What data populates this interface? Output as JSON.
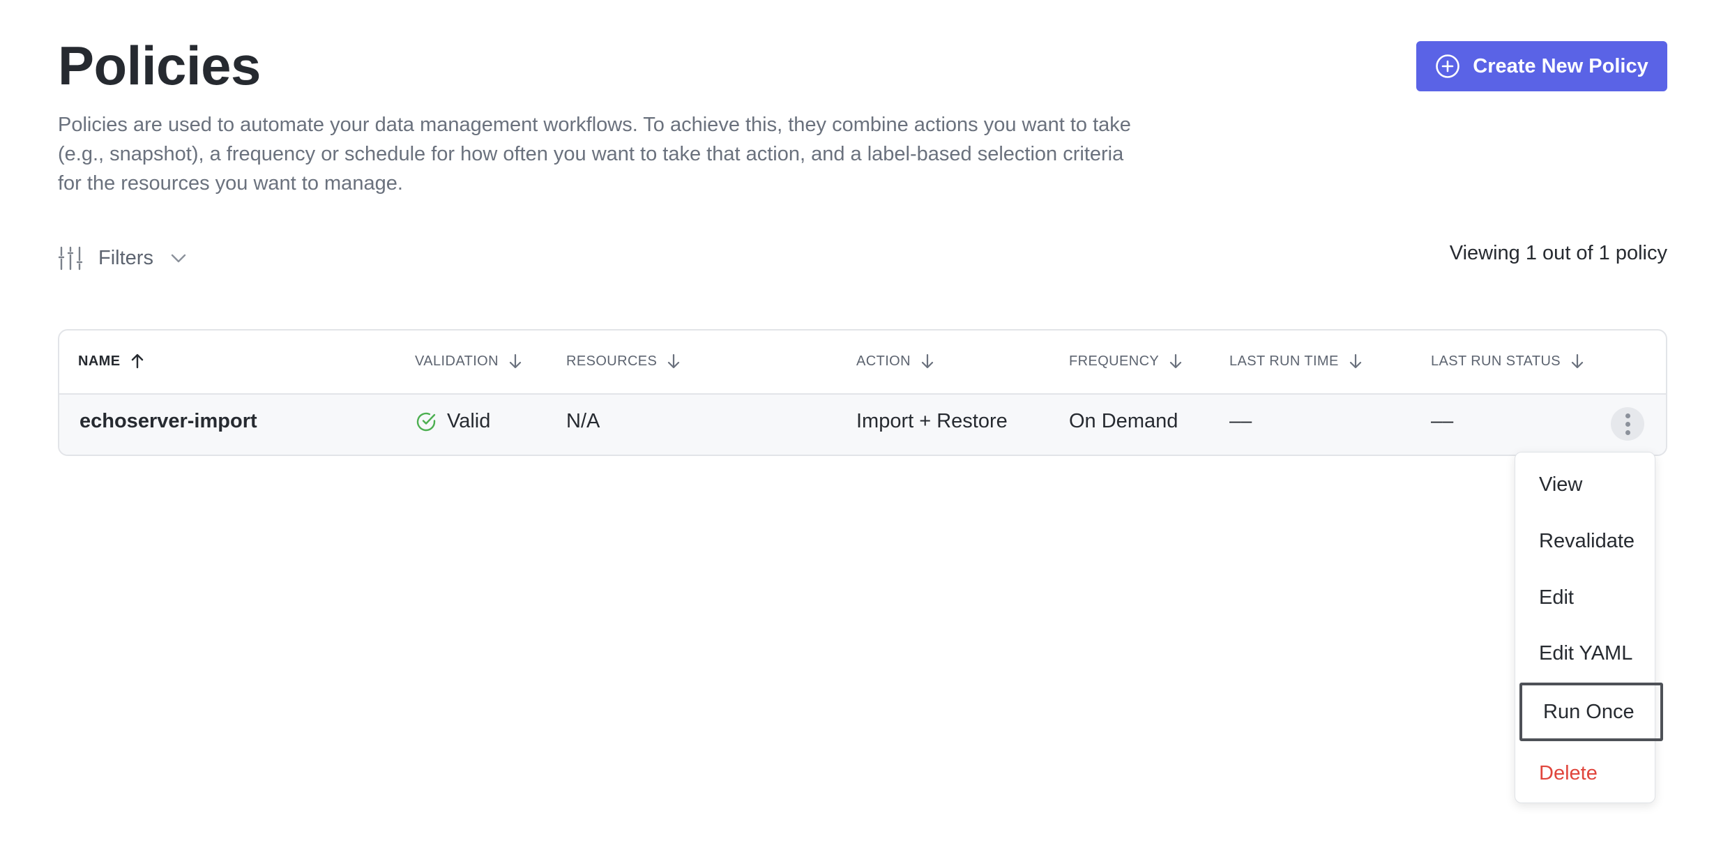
{
  "header": {
    "title": "Policies",
    "description": "Policies are used to automate your data management workflows. To achieve this, they combine actions you want to take (e.g., snapshot), a frequency or schedule for how often you want to take that action, and a label-based selection criteria for the resources you want to manage.",
    "create_button_label": "Create New Policy"
  },
  "toolbar": {
    "filters_label": "Filters",
    "viewing_text": "Viewing 1 out of 1 policy"
  },
  "table": {
    "columns": [
      {
        "label": "NAME",
        "sort": "asc",
        "active": true
      },
      {
        "label": "VALIDATION",
        "sort": "desc"
      },
      {
        "label": "RESOURCES",
        "sort": "desc"
      },
      {
        "label": "ACTION",
        "sort": "desc"
      },
      {
        "label": "FREQUENCY",
        "sort": "desc"
      },
      {
        "label": "LAST RUN TIME",
        "sort": "desc"
      },
      {
        "label": "LAST RUN STATUS",
        "sort": "desc"
      }
    ],
    "rows": [
      {
        "name": "echoserver-import",
        "validation": "Valid",
        "resources": "N/A",
        "action": "Import + Restore",
        "frequency": "On Demand",
        "last_run_time": "––",
        "last_run_status": "––"
      }
    ]
  },
  "row_menu": {
    "items": [
      {
        "label": "View"
      },
      {
        "label": "Revalidate"
      },
      {
        "label": "Edit"
      },
      {
        "label": "Edit YAML"
      },
      {
        "label": "Run Once",
        "focused": true
      },
      {
        "label": "Delete",
        "danger": true
      }
    ]
  },
  "colors": {
    "primary": "#5a63e6",
    "valid": "#4caf50",
    "danger": "#e0453c",
    "text": "#262a30",
    "muted": "#6a717d"
  },
  "icons": {
    "create": "plus-circle-icon",
    "filters": "sliders-icon",
    "filters_toggle": "chevron-down-icon",
    "sort_asc": "arrow-up-icon",
    "sort_desc": "arrow-down-icon",
    "valid": "check-circle-icon",
    "row_actions": "kebab-icon"
  }
}
